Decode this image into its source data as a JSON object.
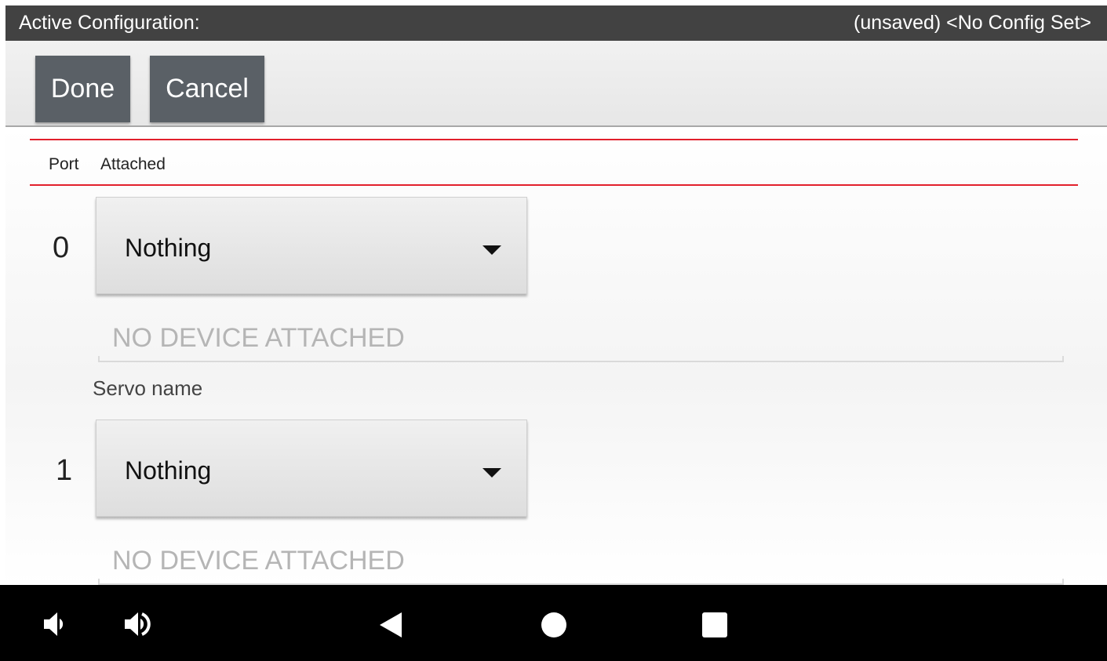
{
  "status_bar": {
    "left_text": "Active Configuration:",
    "right_text": "(unsaved) <No Config Set>"
  },
  "toolbar": {
    "done_label": "Done",
    "cancel_label": "Cancel"
  },
  "table_header": {
    "port": "Port",
    "attached": "Attached"
  },
  "ports": [
    {
      "number": "0",
      "device": "Nothing",
      "name_placeholder": "NO DEVICE ATTACHED",
      "name_label": "Servo name"
    },
    {
      "number": "1",
      "device": "Nothing",
      "name_placeholder": "NO DEVICE ATTACHED"
    }
  ],
  "nav_bar": {
    "icons": [
      "volume-down-icon",
      "volume-up-icon",
      "back-icon",
      "home-icon",
      "recents-icon"
    ]
  },
  "colors": {
    "status_bar_bg": "#424242",
    "button_bg": "#5a6066",
    "accent_red": "#e2202c",
    "nav_bar_bg": "#000000"
  }
}
